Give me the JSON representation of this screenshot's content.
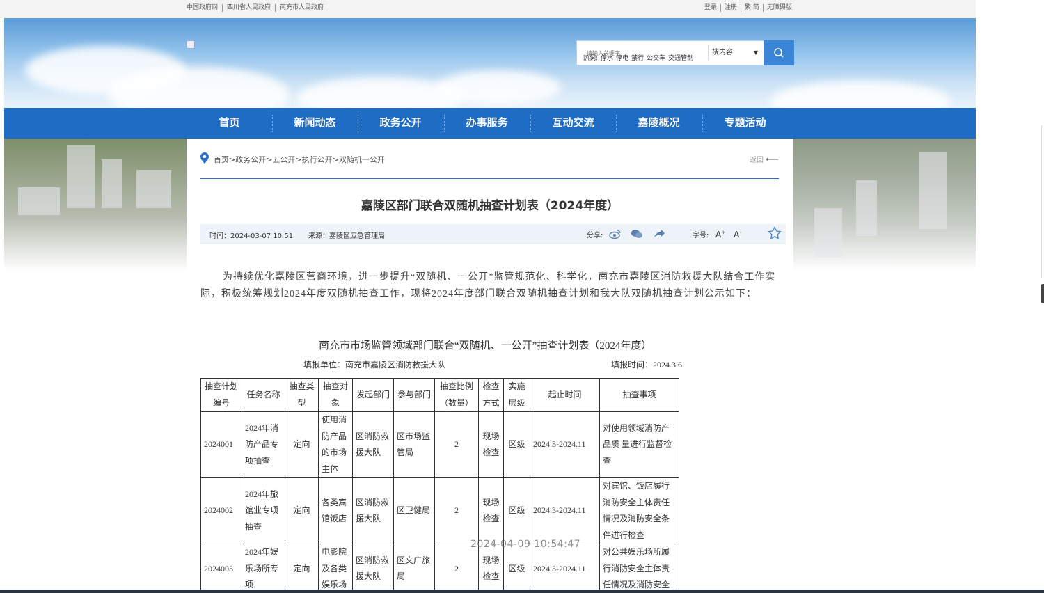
{
  "top_links": [
    "中国政府网",
    "四川省人民政府",
    "南充市人民政府"
  ],
  "top_right": [
    "登录",
    "注册",
    "繁 简",
    "无障碍版"
  ],
  "search": {
    "placeholder": "请输入关键字",
    "scope": "搜内容"
  },
  "hotwords": {
    "label": "热词:",
    "items": [
      "停水",
      "停电",
      "禁行",
      "公交车",
      "交通管制"
    ]
  },
  "nav": [
    "首页",
    "新闻动态",
    "政务公开",
    "办事服务",
    "互动交流",
    "嘉陵概况",
    "专题活动"
  ],
  "nav_active": "政务公开",
  "breadcrumb": "首页>政务公开>五公开>执行公开>双随机一公开",
  "back_label": "返回",
  "article": {
    "title": "嘉陵区部门联合双随机抽查计划表（2024年度）",
    "time": "时间：2024-03-07 10:51",
    "source": "来源：嘉陵区应急管理局",
    "share_label": "分享:",
    "fontsize_label": "字号:",
    "body": "为持续优化嘉陵区营商环境，进一步提升“双随机、一公开”监管规范化、科学化，南充市嘉陵区消防救援大队结合工作实际，积极统筹规划2024年度双随机抽查工作，现将2024年度部门联合双随机抽查计划和我大队双随机抽查计划公示如下："
  },
  "table": {
    "title": "南充市市场监管领域部门联合“双随机、一公开”抽查计划表（2024年度）",
    "unit": "填报单位：南充市嘉陵区消防救援大队",
    "date": "填报时间：2024.3.6",
    "headers": [
      "抽查计划编号",
      "任务名称",
      "抽查类型",
      "抽查对象",
      "发起部门",
      "参与部门",
      "抽查比例（数量）",
      "检查方式",
      "实施层级",
      "起止时间",
      "抽查事项"
    ],
    "rows": [
      [
        "2024001",
        "2024年消防产品专项抽查",
        "定向",
        "使用消防产品的市场主体",
        "区消防救援大队",
        "区市场监管局",
        "2",
        "现场检查",
        "区级",
        "2024.3-2024.11",
        "对使用领域消防产品质 量进行监督检查"
      ],
      [
        "2024002",
        "2024年旅馆业专项抽查",
        "定向",
        "各类宾馆饭店",
        "区消防救援大队",
        "区卫健局",
        "2",
        "现场检查",
        "区级",
        "2024.3-2024.11",
        "对宾馆、饭店履行消防安全主体责任情况及消防安全条件进行检查"
      ],
      [
        "2024003",
        "2024年娱乐场所专项",
        "定向",
        "电影院及各类娱乐场",
        "区消防救援大队",
        "区文广旅局",
        "2",
        "现场检查",
        "区级",
        "2024.3-2024.11",
        "对公共娱乐场所履行消防安全主体责任情况及消防安全"
      ]
    ]
  },
  "timestamp": "2024-04-09 10:54:47",
  "colors": {
    "nav": "#1e6cc4",
    "search_button": "#3a85d6",
    "meta_bg": "#eef3f9"
  }
}
